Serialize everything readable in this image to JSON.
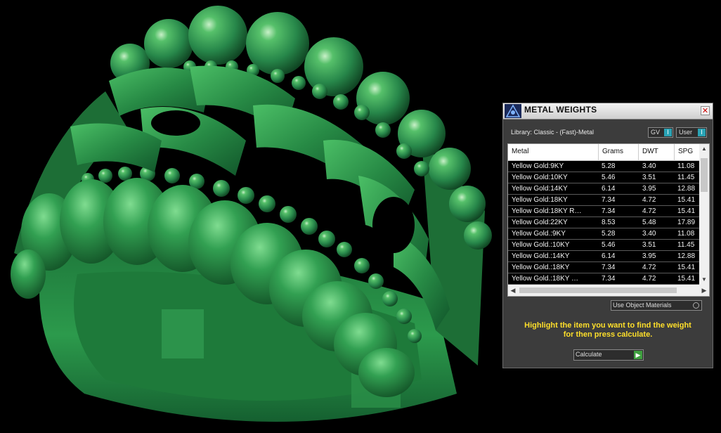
{
  "panel": {
    "title": "METAL WEIGHTS",
    "close_glyph": "✕",
    "library_label": "Library: Classic - (Fast)-Metal",
    "gv_label": "GV",
    "user_label": "User",
    "toggle_glyph": "I"
  },
  "table": {
    "columns": [
      "Metal",
      "Grams",
      "DWT",
      "SPG"
    ],
    "rows": [
      [
        "Yellow Gold:9KY",
        "5.28",
        "3.40",
        "11.08"
      ],
      [
        "Yellow Gold:10KY",
        "5.46",
        "3.51",
        "11.45"
      ],
      [
        "Yellow Gold:14KY",
        "6.14",
        "3.95",
        "12.88"
      ],
      [
        "Yellow Gold:18KY",
        "7.34",
        "4.72",
        "15.41"
      ],
      [
        "Yellow Gold:18KY R…",
        "7.34",
        "4.72",
        "15.41"
      ],
      [
        "Yellow Gold:22KY",
        "8.53",
        "5.48",
        "17.89"
      ],
      [
        "Yellow Gold.:9KY",
        "5.28",
        "3.40",
        "11.08"
      ],
      [
        "Yellow Gold.:10KY",
        "5.46",
        "3.51",
        "11.45"
      ],
      [
        "Yellow Gold.:14KY",
        "6.14",
        "3.95",
        "12.88"
      ],
      [
        "Yellow Gold.:18KY",
        "7.34",
        "4.72",
        "15.41"
      ],
      [
        "Yellow Gold.:18KY …",
        "7.34",
        "4.72",
        "15.41"
      ]
    ]
  },
  "use_object_materials_label": "Use Object Materials",
  "hint_line1": "Highlight the item you want to find the weight",
  "hint_line2": "for then press calculate.",
  "calculate_label": "Calculate",
  "colors": {
    "ring_green": "#2a8a4a",
    "hint_yellow": "#ffdf2a",
    "panel_bg": "#3c3c3c"
  },
  "icons": {
    "logo": "app-logo-icon",
    "close": "close-icon",
    "go": "play-arrow-icon"
  }
}
